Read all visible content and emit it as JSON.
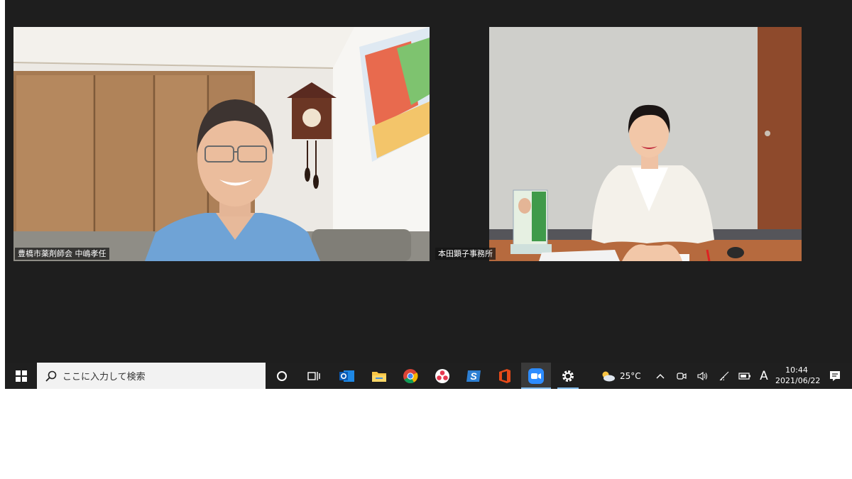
{
  "participants": [
    {
      "name": "豊橋市薬剤師会 中嶋孝任"
    },
    {
      "name": "本田顕子事務所"
    }
  ],
  "taskbar": {
    "search_placeholder": "ここに入力して検索",
    "weather_temp": "25°C",
    "ime_mode": "A",
    "clock_time": "10:44",
    "clock_date": "2021/06/22"
  },
  "colors": {
    "window_bg": "#1e1e1e",
    "taskbar_bg": "#1f1f1f",
    "active_indicator": "#7fb8e8"
  }
}
